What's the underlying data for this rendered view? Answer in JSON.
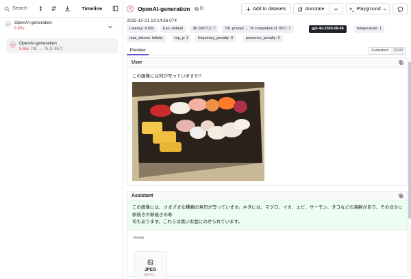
{
  "left": {
    "search_label": "Search",
    "timeline_label": "Timeline",
    "root": {
      "badge": "¥S",
      "title": "OpenAI-generation",
      "duration": "8.65s"
    },
    "child": {
      "title": "OpenAI-generation",
      "duration": "8.65s",
      "tokens": "781 → 76 (Σ 857)"
    }
  },
  "header": {
    "title": "OpenAI-generation",
    "id_label": "ID",
    "add_to_datasets": "Add to datasets",
    "annotate": "Annotate",
    "playground": "Playground",
    "timestamp": "2025-10-21 19:14:36.074"
  },
  "chips": [
    "Latency: 8.65s",
    "Env: default",
    "$0.002713",
    "781 prompt → 76 completion (Σ 857)",
    "gpt-4o-2024-08-06",
    "temperature: 1",
    "max_tokens: Infinity",
    "top_p: 1",
    "frequency_penalty: 0",
    "presence_penalty: 0"
  ],
  "tabs": {
    "preview": "Preview",
    "formatted": "Formatted",
    "json": "JSON"
  },
  "user": {
    "heading": "User",
    "message": "この画像には何が写っていますか?"
  },
  "assistant": {
    "heading": "Assistant",
    "line1": "この画像には、さまざまな種類の寿司が写っています。ネタには、マグロ、イカ、エビ、サーモン、タコなどの海鮮があり、そのほかに卵焼きや卵焼きの寿",
    "line2": "司もあります。これらは黒いお盆にのせられています。"
  },
  "media": {
    "label": "Media",
    "type": "JPEG",
    "name": "gtd-D..."
  },
  "colors": {
    "accent": "#6e56cf",
    "dark_chip": "#1f2328",
    "assistant_bg": "#ecfdf3",
    "error_red": "#e5484d"
  }
}
